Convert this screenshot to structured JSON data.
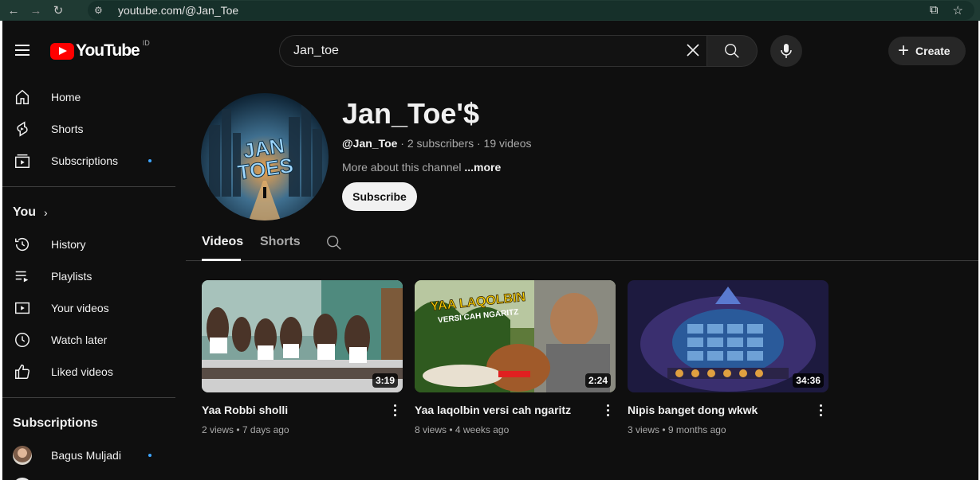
{
  "browser": {
    "url": "youtube.com/@Jan_Toe",
    "back_icon": "arrow-left-icon",
    "forward_icon": "arrow-right-icon",
    "reload_icon": "reload-icon"
  },
  "header": {
    "logo_text": "YouTube",
    "region": "ID",
    "search_value": "Jan_toe",
    "create_label": "Create"
  },
  "sidebar": {
    "main": [
      {
        "label": "Home",
        "icon": "home-icon"
      },
      {
        "label": "Shorts",
        "icon": "shorts-icon"
      },
      {
        "label": "Subscriptions",
        "icon": "subscriptions-icon",
        "dot": true
      }
    ],
    "you_heading": "You",
    "you": [
      {
        "label": "History",
        "icon": "history-icon"
      },
      {
        "label": "Playlists",
        "icon": "playlists-icon"
      },
      {
        "label": "Your videos",
        "icon": "your-videos-icon"
      },
      {
        "label": "Watch later",
        "icon": "watch-later-icon"
      },
      {
        "label": "Liked videos",
        "icon": "liked-videos-icon"
      }
    ],
    "subscriptions_heading": "Subscriptions",
    "subscriptions": [
      {
        "label": "Bagus Muljadi",
        "dot": true
      }
    ]
  },
  "channel": {
    "name": "Jan_Toe'$",
    "handle": "@Jan_Toe",
    "stats": " · 2 subscribers · 19 videos",
    "about": "More about this channel ",
    "more": "...more",
    "subscribe_label": "Subscribe",
    "avatar_text": "JAN TOES"
  },
  "tabs": [
    {
      "label": "Videos",
      "active": true
    },
    {
      "label": "Shorts",
      "active": false
    }
  ],
  "videos": [
    {
      "title": "Yaa Robbi sholli",
      "meta": "2 views • 7 days ago",
      "duration": "3:19"
    },
    {
      "title": "Yaa laqolbin versi cah ngaritz",
      "meta": "8 views • 4 weeks ago",
      "duration": "2:24",
      "thumb_text_1": "YAA LAQOLBIN",
      "thumb_text_2": "VERSI CAH NGARITZ"
    },
    {
      "title": "Nipis banget dong wkwk",
      "meta": "3 views • 9 months ago",
      "duration": "34:36"
    }
  ],
  "colors": {
    "background": "#0f0f0f",
    "brand_red": "#ff0000",
    "accent_blue": "#3ea6ff",
    "browser_bar": "#1f3a33"
  }
}
